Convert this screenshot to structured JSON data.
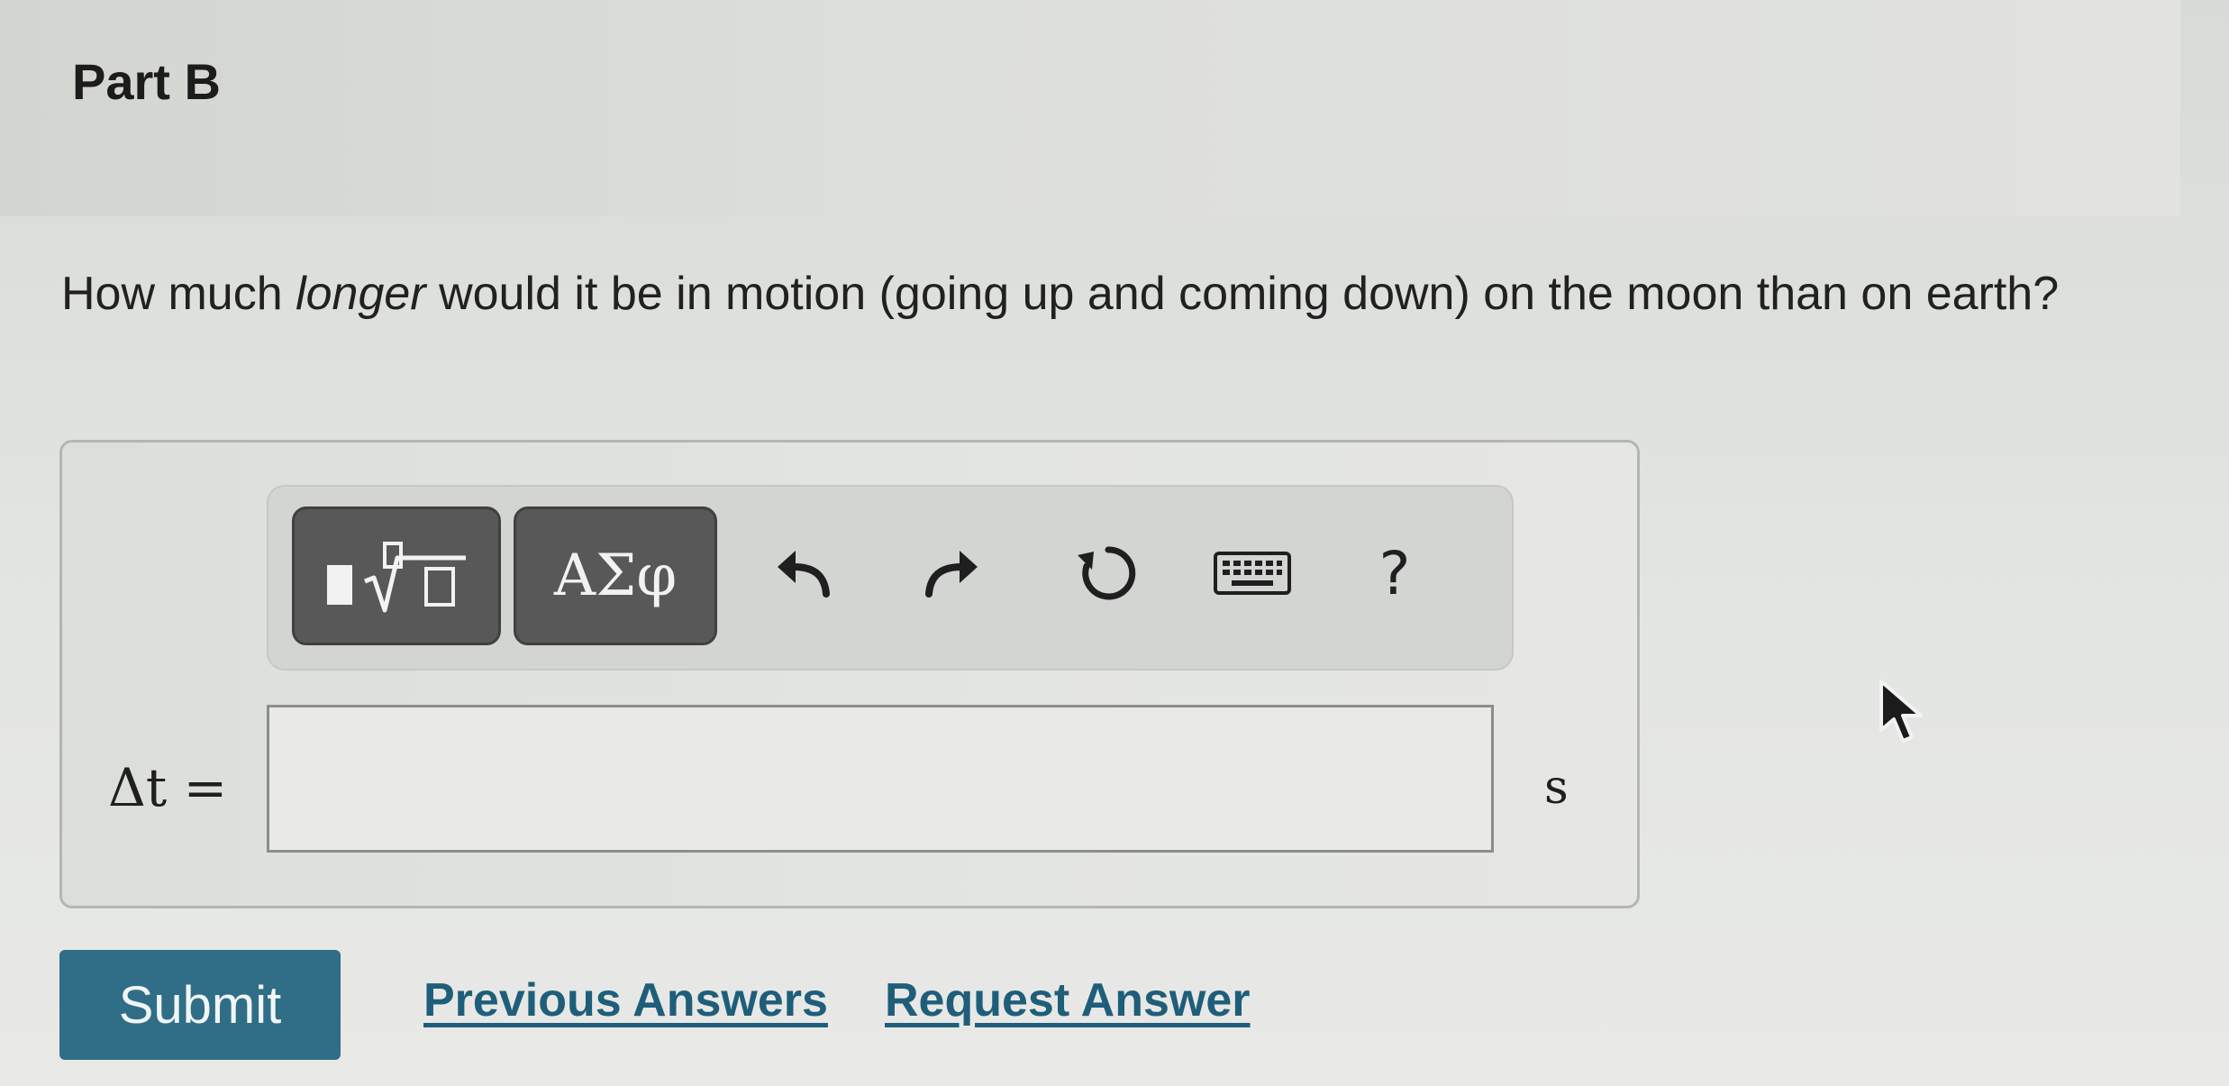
{
  "part": {
    "title": "Part B"
  },
  "question": {
    "text_before": "How much ",
    "emphasis": "longer",
    "text_after": " would it be in motion (going up and coming down) on the moon than on earth?"
  },
  "toolbar": {
    "templates_icon": "fraction-root-template-icon",
    "greek_label": "ΑΣφ",
    "undo_icon": "undo-icon",
    "redo_icon": "redo-icon",
    "reset_icon": "reset-icon",
    "keyboard_icon": "keyboard-icon",
    "help_label": "?"
  },
  "answer": {
    "variable_label": "Δt =",
    "value": "",
    "unit": "s"
  },
  "actions": {
    "submit_label": "Submit",
    "previous_answers_label": "Previous Answers",
    "request_answer_label": "Request Answer"
  },
  "colors": {
    "submit_bg": "#2f6e86",
    "link": "#1f5e7a",
    "toolbar_button_bg": "#575857"
  }
}
